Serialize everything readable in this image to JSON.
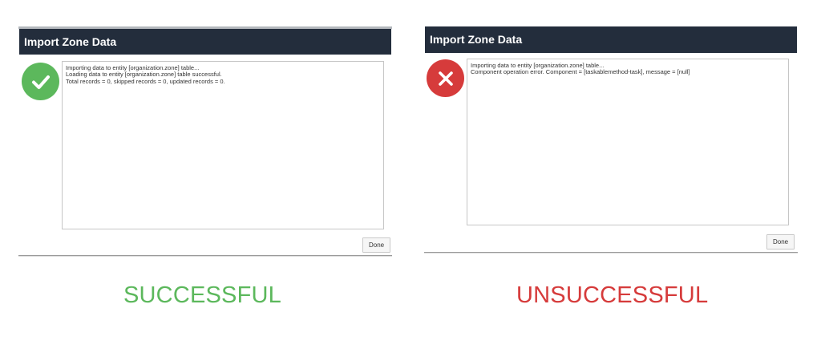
{
  "colors": {
    "titlebar": "#232d3c",
    "success": "#5cb85c",
    "failure": "#d63b3b"
  },
  "success_dialog": {
    "title": "Import Zone Data",
    "status_icon": "check-icon",
    "log_lines": [
      "Importing data to entity [organization.zone] table...",
      "Loading data to entity [organization.zone] table successful.",
      "Total records = 0, skipped records = 0, updated records = 0."
    ],
    "done_label": "Done",
    "caption": "SUCCESSFUL"
  },
  "failure_dialog": {
    "title": "Import Zone Data",
    "status_icon": "x-icon",
    "log_lines": [
      "Importing data to entity [organization.zone] table...",
      "Component operation error. Component = [taskablemethod-task], message = [null]"
    ],
    "done_label": "Done",
    "caption": "UNSUCCESSFUL"
  }
}
